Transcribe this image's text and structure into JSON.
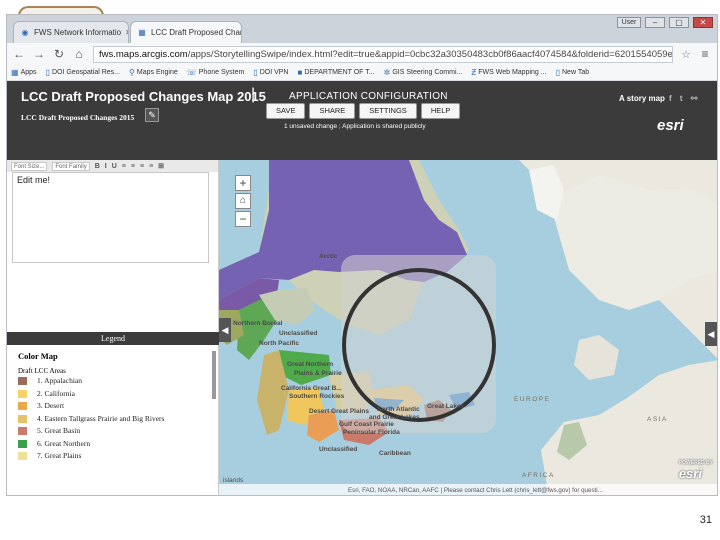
{
  "browser": {
    "tabs": [
      {
        "label": "FWS Network Informatio",
        "icon": "globe-icon"
      },
      {
        "label": "LCC Draft Proposed Chan",
        "icon": "story-map-icon"
      }
    ],
    "window_user": "User",
    "address": {
      "host": "fws.maps.arcgis.com",
      "path": "/apps/StorytellingSwipe/index.html?edit=true&appid=0cbc32a30350483cb0f86aacf4074584&folderid=6201554059e94"
    },
    "bookmarks": [
      {
        "label": "Apps",
        "icon": "apps-icon"
      },
      {
        "label": "DOI Geospatial Res...",
        "icon": "doc-icon"
      },
      {
        "label": "Maps Engine",
        "icon": "map-pin-icon"
      },
      {
        "label": "Phone System",
        "icon": "phone-icon"
      },
      {
        "label": "DOI VPN",
        "icon": "doc-icon"
      },
      {
        "label": "DEPARTMENT OF T...",
        "icon": "doi-icon"
      },
      {
        "label": "GIS Steering Commi...",
        "icon": "gear-icon"
      },
      {
        "label": "FWS Web Mapping ...",
        "icon": "z-icon"
      },
      {
        "label": "New Tab",
        "icon": "doc-icon"
      }
    ]
  },
  "app": {
    "title": "LCC Draft Proposed Changes Map 2015",
    "subtitle": "LCC Draft Proposed Changes 2015",
    "config_title": "APPLICATION CONFIGURATION",
    "buttons": {
      "save": "SAVE",
      "share": "SHARE",
      "settings": "SETTINGS",
      "help": "HELP"
    },
    "status": "1 unsaved change ; Application is shared publicly",
    "story_map_label": "A story map",
    "esri_label": "esri"
  },
  "editor": {
    "font_size": "Font Size...",
    "font_family": "Font Family",
    "format_buttons": [
      "B",
      "I",
      "U",
      "≡",
      "≡",
      "≡",
      "≡",
      "⊞"
    ],
    "content": "Edit me!"
  },
  "legend": {
    "header": "Legend",
    "title": "Color Map",
    "subtitle": "Draft LCC Areas",
    "items": [
      {
        "label": "1. Appalachian",
        "color": "#9b6b5c"
      },
      {
        "label": "2. California",
        "color": "#f4d36a"
      },
      {
        "label": "3. Desert",
        "color": "#e9a94a"
      },
      {
        "label": "4. Eastern Tallgrass Prairie and Big Rivers",
        "color": "#e6c36b"
      },
      {
        "label": "5. Great Basin",
        "color": "#c97a6b"
      },
      {
        "label": "6. Great Northern",
        "color": "#3aa14a"
      },
      {
        "label": "7. Great Plains",
        "color": "#f0e19a"
      }
    ]
  },
  "map": {
    "labels": {
      "northern_boreal": "Northern Boreal",
      "north_pacific": "North Pacific",
      "unclassified_north": "Unclassified",
      "great_northern": "Great Northern",
      "plains_prairie": "Plains & Prairie",
      "california_great": "California Great B...",
      "southern_rockies": "Southern Rockies",
      "desert": "Desert Great Plains",
      "gulf_coast": "Gulf Coast Prairie",
      "peninsular_florida": "Peninsular Florida",
      "unclassified_south": "Unclassified",
      "caribbean": "Caribbean",
      "north_atlantic": "North Atlantic",
      "great_lakes_upper": "Great Lakes",
      "great_lakes_lower": "and Great Lakes",
      "arctic": "Arctic",
      "europe": "EUROPE",
      "asia": "ASIA",
      "africa": "AFRICA",
      "islands": "islands"
    },
    "attribution": "Esri, FAO, NOAA, NRCan, AAFC | Please contact Chris Lett (chris_lett@fws.gov) for questi...",
    "powered_by": "POWERED BY",
    "esri_label": "esri"
  },
  "page_number": "31"
}
